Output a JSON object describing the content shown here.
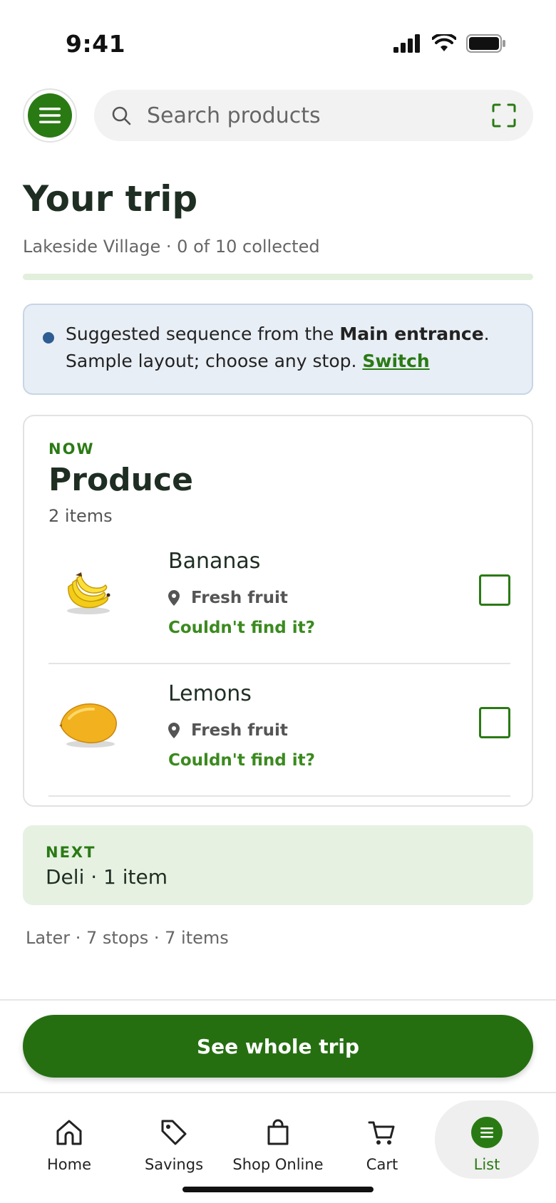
{
  "status": {
    "time": "9:41"
  },
  "search": {
    "placeholder": "Search products"
  },
  "trip": {
    "title": "Your trip",
    "subtitle": "Lakeside Village · 0 of 10 collected",
    "progress": 0
  },
  "notice": {
    "text_before": "Suggested sequence from the ",
    "bold": "Main entrance",
    "text_after": ". Sample layout; choose any stop. ",
    "link": "Switch"
  },
  "now": {
    "label": "NOW",
    "title": "Produce",
    "count": "2 items",
    "items": [
      {
        "name": "Bananas",
        "location": "Fresh fruit",
        "cant_find": "Couldn't find it?",
        "checked": false
      },
      {
        "name": "Lemons",
        "location": "Fresh fruit",
        "cant_find": "Couldn't find it?",
        "checked": false
      }
    ]
  },
  "next": {
    "label": "NEXT",
    "title": "Deli · 1 item"
  },
  "later": "Later · 7 stops · 7 items",
  "cta": "See whole trip",
  "tabs": [
    {
      "label": "Home",
      "icon": "home-icon"
    },
    {
      "label": "Savings",
      "icon": "tag-icon"
    },
    {
      "label": "Shop Online",
      "icon": "shopping-bag-icon"
    },
    {
      "label": "Cart",
      "icon": "cart-icon"
    },
    {
      "label": "List",
      "icon": "list-icon",
      "active": true
    }
  ],
  "colors": {
    "brand": "#2a7a14",
    "cta": "#256f10",
    "next_bg": "#e6f1e2",
    "notice_bg": "#e8eef5"
  }
}
